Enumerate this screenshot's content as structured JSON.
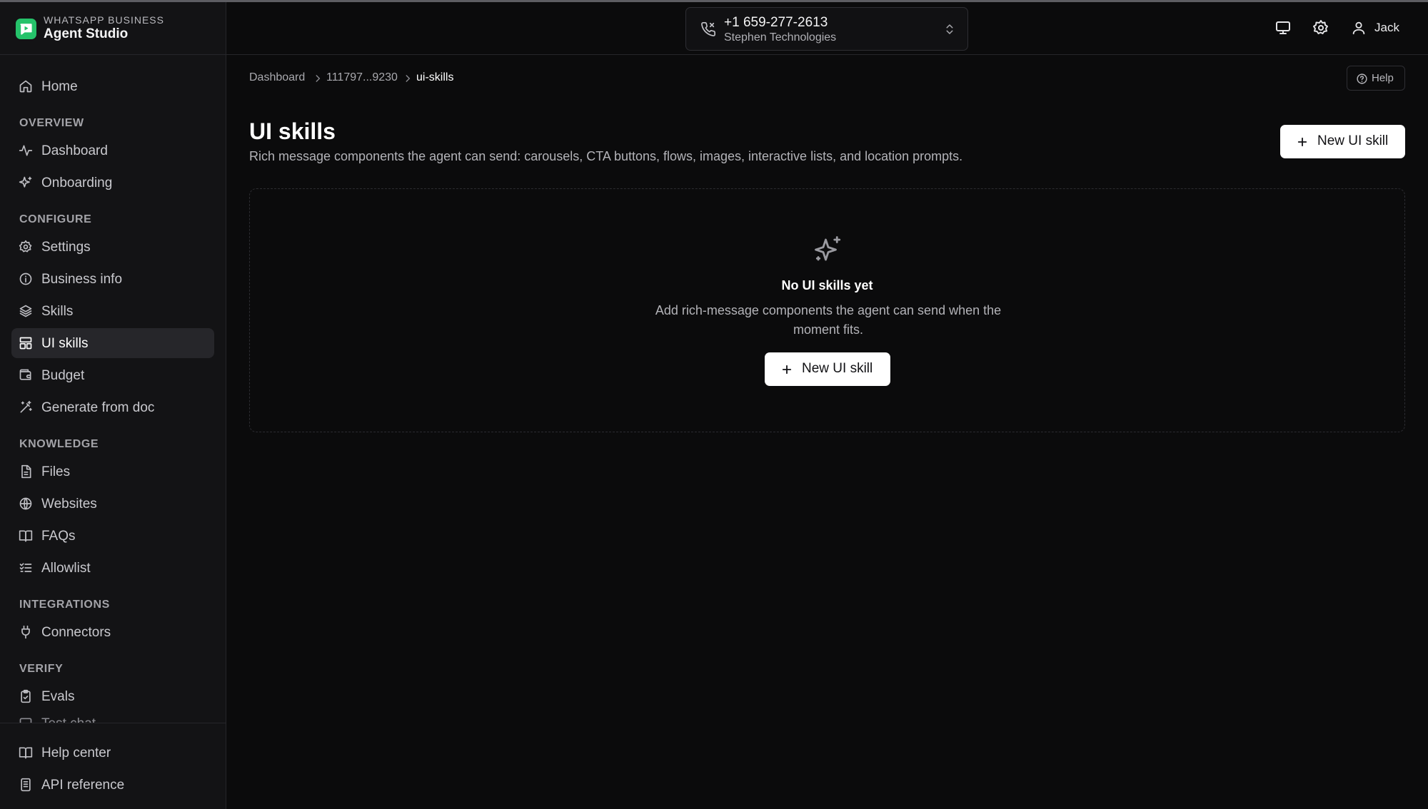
{
  "brand": {
    "kicker": "WHATSAPP BUSINESS",
    "name": "Agent Studio",
    "accent_color": "#25c26a"
  },
  "sidebar": {
    "home": {
      "label": "Home",
      "icon": "home-icon"
    },
    "sections": {
      "overview": "OVERVIEW",
      "configure": "CONFIGURE",
      "knowledge": "KNOWLEDGE",
      "integrations": "INTEGRATIONS",
      "verify": "VERIFY"
    },
    "items": {
      "dashboard": {
        "label": "Dashboard",
        "icon": "activity-icon"
      },
      "onboarding": {
        "label": "Onboarding",
        "icon": "sparkles-icon"
      },
      "settings": {
        "label": "Settings",
        "icon": "gear-icon"
      },
      "business_info": {
        "label": "Business info",
        "icon": "info-icon"
      },
      "skills": {
        "label": "Skills",
        "icon": "layers-icon"
      },
      "ui_skills": {
        "label": "UI skills",
        "icon": "layout-icon",
        "active": true
      },
      "budget": {
        "label": "Budget",
        "icon": "wallet-icon"
      },
      "generate_from_doc": {
        "label": "Generate from doc",
        "icon": "wand-icon"
      },
      "files": {
        "label": "Files",
        "icon": "file-icon"
      },
      "websites": {
        "label": "Websites",
        "icon": "globe-icon"
      },
      "faqs": {
        "label": "FAQs",
        "icon": "book-icon"
      },
      "allowlist": {
        "label": "Allowlist",
        "icon": "list-checks-icon"
      },
      "connectors": {
        "label": "Connectors",
        "icon": "plug-icon"
      },
      "evals": {
        "label": "Evals",
        "icon": "clipboard-icon"
      },
      "test_chat": {
        "label": "Test chat",
        "icon": "chat-icon"
      }
    },
    "bottom": {
      "help_center": {
        "label": "Help center",
        "icon": "book-icon"
      },
      "api_reference": {
        "label": "API reference",
        "icon": "document-icon"
      }
    }
  },
  "header": {
    "phone_number": "+1 659-277-2613",
    "company": "Stephen Technologies",
    "user_name": "Jack"
  },
  "breadcrumb": [
    "Dashboard",
    "111797...9230",
    "ui-skills"
  ],
  "help_label": "Help",
  "page": {
    "title": "UI skills",
    "description": "Rich message components the agent can send: carousels, CTA buttons, flows, images, interactive lists, and location prompts.",
    "new_button_label": "New UI skill"
  },
  "empty_state": {
    "title": "No UI skills yet",
    "description": "Add rich-message components the agent can send when the moment fits.",
    "button_label": "New UI skill"
  }
}
